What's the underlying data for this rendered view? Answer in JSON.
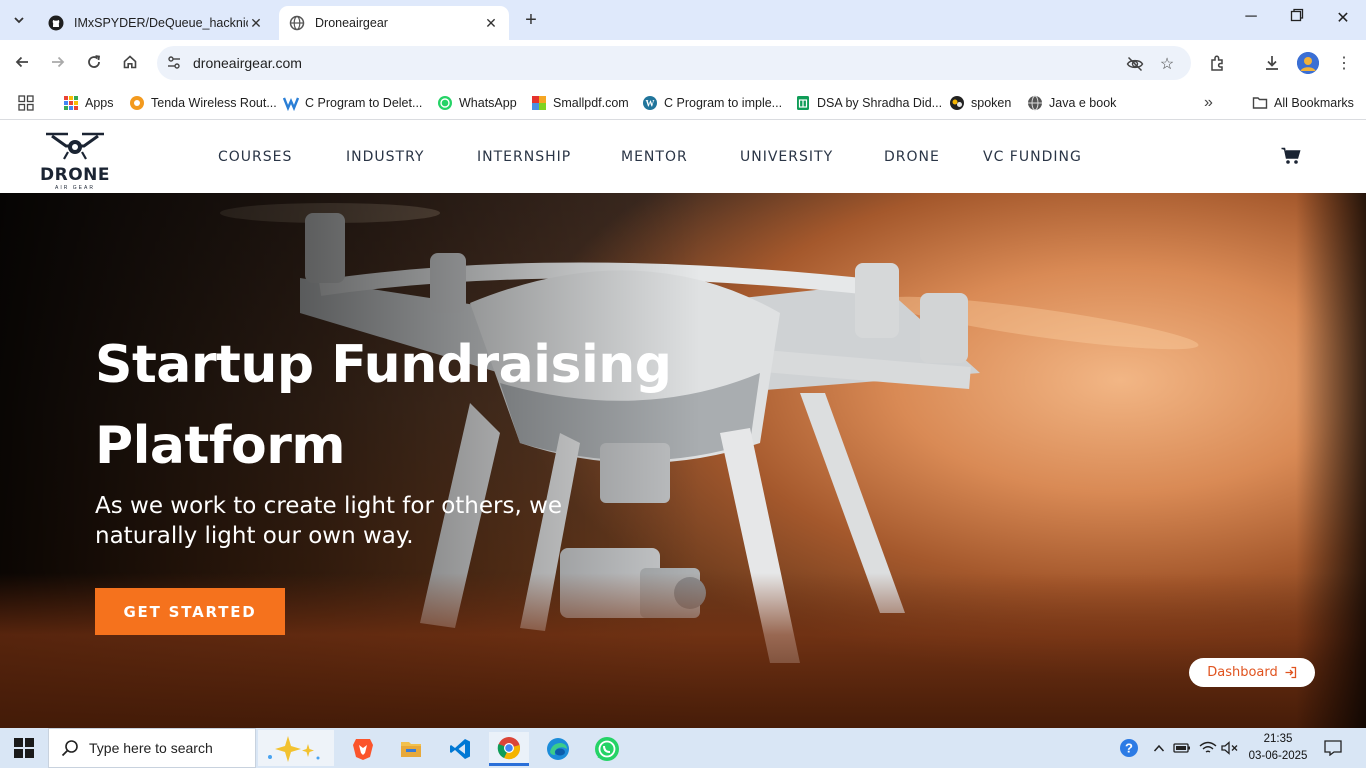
{
  "browser": {
    "tabs": [
      {
        "title": "IMxSPYDER/DeQueue_hacknich",
        "icon": "github-icon"
      },
      {
        "title": "Droneairgear",
        "icon": "globe-icon",
        "active": true
      }
    ],
    "address": "droneairgear.com",
    "bookmarks": [
      {
        "label": "Apps",
        "icon": "apps-grid-icon"
      },
      {
        "label": "Tenda Wireless Rout...",
        "icon": "tenda-icon"
      },
      {
        "label": "C Program to Delet...",
        "icon": "site-icon"
      },
      {
        "label": "WhatsApp",
        "icon": "whatsapp-icon"
      },
      {
        "label": "Smallpdf.com",
        "icon": "smallpdf-icon"
      },
      {
        "label": "C Program to imple...",
        "icon": "wordpress-icon"
      },
      {
        "label": "DSA by Shradha Did...",
        "icon": "sheets-icon"
      },
      {
        "label": "spoken",
        "icon": "spoken-icon"
      },
      {
        "label": "Java e book",
        "icon": "globe-icon"
      }
    ],
    "all_bookmarks": "All Bookmarks"
  },
  "site": {
    "logo_text": "DRONE",
    "logo_sub": "AIR GEAR",
    "nav": [
      "COURSES",
      "INDUSTRY",
      "INTERNSHIP",
      "MENTOR",
      "UNIVERSITY",
      "DRONE",
      "VC FUNDING"
    ],
    "hero_title_line1": "Startup Fundraising",
    "hero_title_line2": "Platform",
    "hero_subtitle": "As we work to create light for others, we naturally light our own way.",
    "cta_label": "GET STARTED",
    "dashboard_label": "Dashboard",
    "accent": "#f5721d"
  },
  "taskbar": {
    "search_placeholder": "Type here to search",
    "time": "21:35",
    "date": "03-06-2025"
  }
}
